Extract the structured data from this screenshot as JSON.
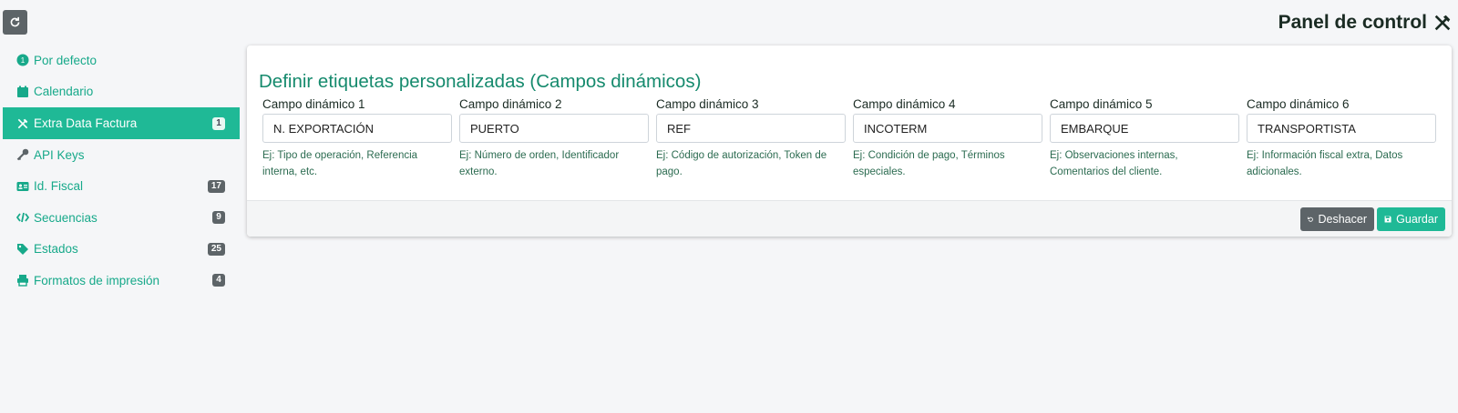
{
  "header": {
    "title": "Panel de control",
    "title_icon": "tools-icon",
    "refresh_icon": "refresh-icon"
  },
  "sidebar": {
    "items": [
      {
        "label": "Por defecto",
        "icon": "number-circle-icon",
        "badge": ""
      },
      {
        "label": "Calendario",
        "icon": "calendar-icon",
        "badge": ""
      },
      {
        "label": "Extra Data Factura",
        "icon": "tools-icon",
        "badge": "1",
        "active": true
      },
      {
        "label": "API Keys",
        "icon": "key-icon",
        "badge": ""
      },
      {
        "label": "Id. Fiscal",
        "icon": "id-card-icon",
        "badge": "17"
      },
      {
        "label": "Secuencias",
        "icon": "code-icon",
        "badge": "9"
      },
      {
        "label": "Estados",
        "icon": "tags-icon",
        "badge": "25"
      },
      {
        "label": "Formatos de impresión",
        "icon": "print-icon",
        "badge": "4"
      }
    ]
  },
  "card": {
    "title": "Definir etiquetas personalizadas (Campos dinámicos)",
    "fields": [
      {
        "label": "Campo dinámico 1",
        "value": "N. EXPORTACIÓN",
        "help": "Ej: Tipo de operación, Referencia interna, etc."
      },
      {
        "label": "Campo dinámico 2",
        "value": "PUERTO",
        "help": "Ej: Número de orden, Identificador externo."
      },
      {
        "label": "Campo dinámico 3",
        "value": "REF",
        "help": "Ej: Código de autorización, Token de pago."
      },
      {
        "label": "Campo dinámico 4",
        "value": "INCOTERM",
        "help": "Ej: Condición de pago, Términos especiales."
      },
      {
        "label": "Campo dinámico 5",
        "value": "EMBARQUE",
        "help": "Ej: Observaciones internas, Comentarios del cliente."
      },
      {
        "label": "Campo dinámico 6",
        "value": "TRANSPORTISTA",
        "help": "Ej: Información fiscal extra, Datos adicionales."
      }
    ],
    "buttons": {
      "undo": "Deshacer",
      "save": "Guardar"
    }
  },
  "colors": {
    "accent": "#1fb996",
    "accent_text": "#17a98a",
    "title_text": "#158a6d",
    "badge_bg": "#5d6468",
    "background": "#f5f6f8"
  }
}
